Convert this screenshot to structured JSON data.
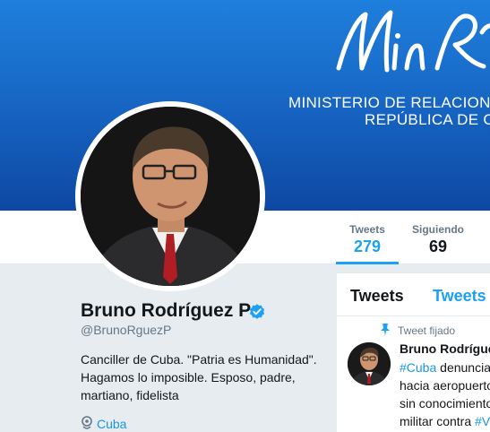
{
  "banner": {
    "logo_text": "MinRex",
    "line1": "MINISTERIO DE RELACIONES",
    "line2": "REPÚBLICA DE C"
  },
  "nav": {
    "tweets_label": "Tweets",
    "tweets_count": "279",
    "following_label": "Siguiendo",
    "following_count": "69"
  },
  "profile": {
    "name": "Bruno Rodríguez P",
    "handle": "@BrunoRguezP",
    "bio_lines": [
      "Canciller de Cuba. \"Patria es Humanidad\".",
      "Hagamos lo imposible. Esposo, padre,",
      "martiano, fidelista"
    ],
    "location": "Cuba"
  },
  "timeline": {
    "tab1": "Tweets",
    "tab2": "Tweets y",
    "pinned_label": "Tweet fijado",
    "tweet_author": "Bruno Rodrígue",
    "tweet_line1_hashtag": "#Cuba",
    "tweet_line1_rest": " denuncia",
    "tweet_line2": "hacia aeropuerto",
    "tweet_line3": "sin conocimiento",
    "tweet_line4_text": "militar contra ",
    "tweet_line4_hashtag": "#V"
  },
  "colors": {
    "accent": "#1da1f2",
    "link": "#1b95e0",
    "banner_top": "#1f7fdc",
    "banner_bottom": "#0d48a3",
    "verified": "#1da1f2"
  }
}
